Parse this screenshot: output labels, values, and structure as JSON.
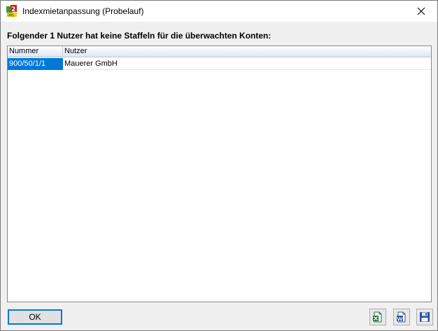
{
  "window": {
    "title": "Indexmietanpassung  (Probelauf)",
    "icon": "app-logo-icon"
  },
  "message": "Folgender 1 Nutzer hat keine Staffeln für die überwachten Konten:",
  "table": {
    "columns": [
      "Nummer",
      "Nutzer"
    ],
    "rows": [
      [
        "900/50/1/1",
        "Mauerer GmbH"
      ]
    ]
  },
  "footer": {
    "ok_label": "OK",
    "tools": [
      "excel-export-icon",
      "word-export-icon",
      "save-icon"
    ]
  },
  "colors": {
    "selection": "#0078d7",
    "header_gradient_end": "#dde6f4"
  }
}
